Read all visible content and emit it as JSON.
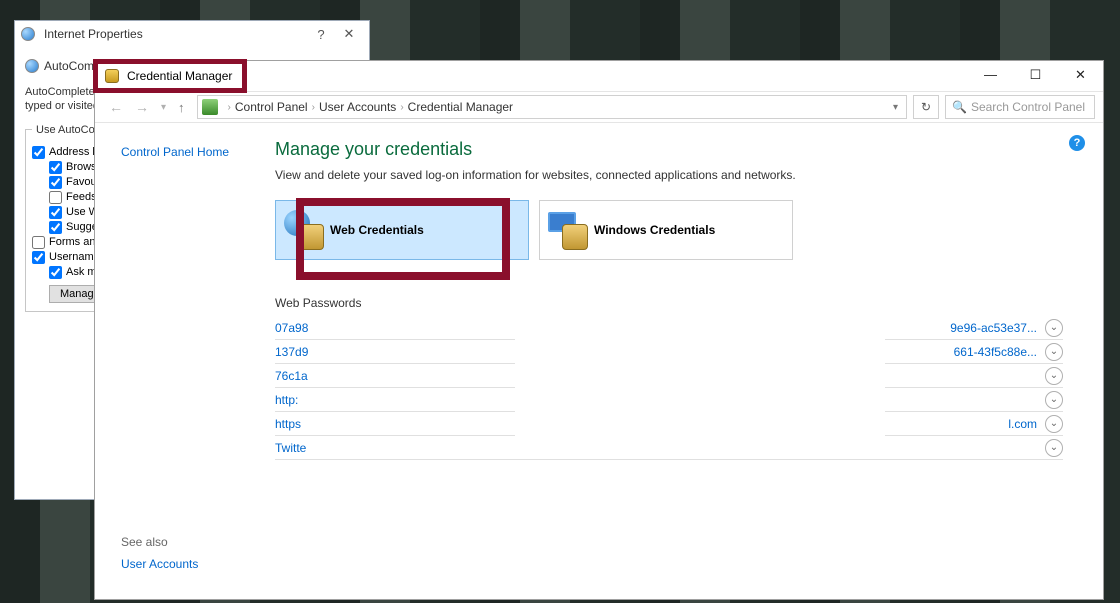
{
  "ie": {
    "title": "Internet Properties",
    "help": "?",
    "close": "✕",
    "autocomplete_header": "AutoComp",
    "desc_line1": "AutoComplete",
    "desc_line2": "typed or visited",
    "useac": "Use AutoComp",
    "addr_bar": "Address ba",
    "browsing": "Browsin",
    "favourites": "Favour",
    "feeds": "Feeds",
    "usewin": "Use Wi",
    "suggest": "Sugges",
    "forms": "Forms and",
    "usernames": "Usernames",
    "askme": "Ask me",
    "manage": "Manage"
  },
  "cm": {
    "title": "Credential Manager",
    "minimize": "—",
    "maximize": "☐",
    "close": "✕",
    "breadcrumb": {
      "control_panel": "Control Panel",
      "user_accounts": "User Accounts",
      "credential_manager": "Credential Manager"
    },
    "search_placeholder": "Search Control Panel",
    "sidebar": {
      "home": "Control Panel Home",
      "see_also": "See also",
      "user_accounts": "User Accounts"
    },
    "heading": "Manage your credentials",
    "subtext": "View and delete your saved log-on information for websites, connected applications and networks.",
    "web_credentials": "Web Credentials",
    "windows_credentials": "Windows Credentials",
    "section_label": "Web Passwords",
    "passwords": [
      {
        "left": "07a98",
        "right": "9e96-ac53e37..."
      },
      {
        "left": "137d9",
        "right": "661-43f5c88e..."
      },
      {
        "left": "76c1a",
        "right": ""
      },
      {
        "left": "http:",
        "right": ""
      },
      {
        "left": "https",
        "right": "l.com"
      },
      {
        "left": "Twitte",
        "right": ""
      }
    ]
  }
}
